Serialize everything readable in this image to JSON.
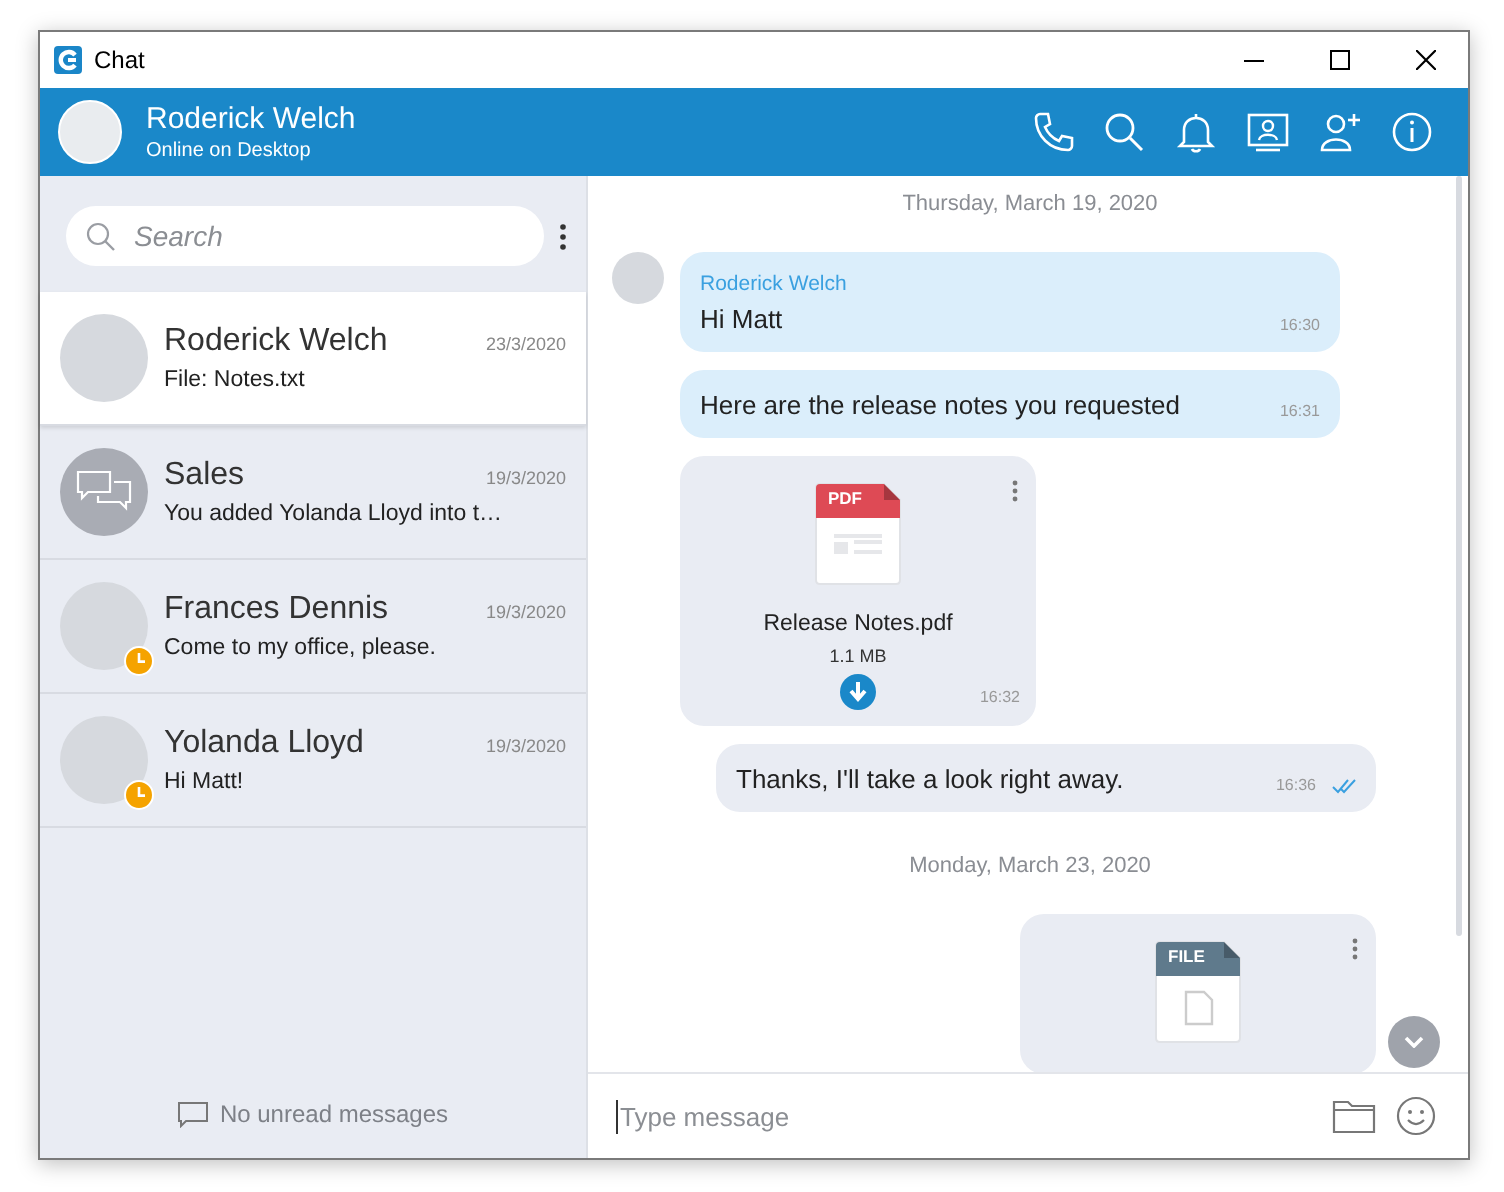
{
  "window": {
    "title": "Chat"
  },
  "header": {
    "name": "Roderick Welch",
    "status": "Online on Desktop"
  },
  "sidebar": {
    "search": {
      "placeholder": "Search"
    },
    "conversations": [
      {
        "kind": "person",
        "name": "Roderick Welch",
        "date": "23/3/2020",
        "preview": "File: Notes.txt",
        "selected": true,
        "away": false
      },
      {
        "kind": "group",
        "name": "Sales",
        "date": "19/3/2020",
        "preview": "You added Yolanda Lloyd into t…",
        "selected": false,
        "away": false
      },
      {
        "kind": "person",
        "name": "Frances Dennis",
        "date": "19/3/2020",
        "preview": "Come to my office, please.",
        "selected": false,
        "away": true
      },
      {
        "kind": "person",
        "name": "Yolanda Lloyd",
        "date": "19/3/2020",
        "preview": "Hi Matt!",
        "selected": false,
        "away": true
      }
    ],
    "footer": "No unread messages"
  },
  "chat": {
    "items": [
      {
        "kind": "date",
        "text": "Thursday, March 19, 2020"
      },
      {
        "kind": "incoming",
        "sender": "Roderick Welch",
        "text": "Hi Matt",
        "time": "16:30"
      },
      {
        "kind": "incoming",
        "text": "Here are the release notes you requested",
        "time": "16:31"
      },
      {
        "kind": "file",
        "outgoing": false,
        "badge": "PDF",
        "name": "Release Notes.pdf",
        "size": "1.1 MB",
        "time": "16:32"
      },
      {
        "kind": "outgoing",
        "text": "Thanks, I'll take a look right away.",
        "time": "16:36",
        "read": true
      },
      {
        "kind": "date",
        "text": "Monday, March 23, 2020"
      },
      {
        "kind": "file",
        "outgoing": true,
        "badge": "FILE"
      }
    ]
  },
  "composer": {
    "placeholder": "Type message"
  }
}
